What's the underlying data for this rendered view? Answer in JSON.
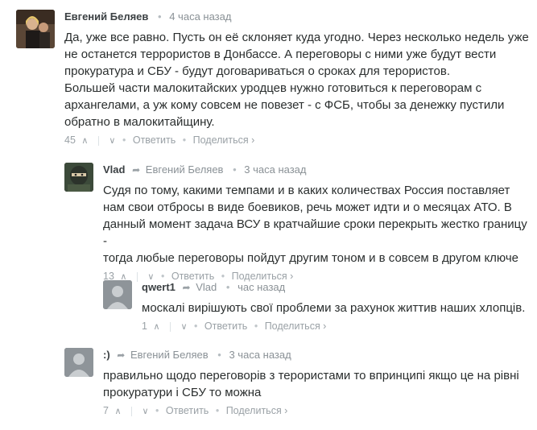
{
  "comments": [
    {
      "author": "Евгений Беляев",
      "reply_to": "",
      "time": "4 часа назад",
      "lines": [
        "Да, уже все равно. Пусть он её склоняет куда угодно. Через несколько недель уже",
        "не останется террористов в Донбассе. А переговоры с ними уже будут вести",
        "прокуратура и СБУ - будут договариваться о сроках для терористов.",
        "Большей части малокитайских уродцев нужно готовиться к переговорам с",
        "архангелами, а уж кому совсем не повезет - с ФСБ, чтобы за денежку пустили",
        "обратно в малокитайщину."
      ],
      "votes": "45",
      "reply_label": "Ответить",
      "share_label": "Поделиться ›"
    },
    {
      "author": "Vlad",
      "reply_to": "Евгений Беляев",
      "time": "3 часа назад",
      "lines": [
        "Судя по тому, какими темпами и в каких количествах Россия поставляет",
        "нам свои отбросы в виде боевиков, речь может идти и о месяцах АТО. В",
        "данный момент задача ВСУ в кратчайшие сроки перекрыть жестко границу -",
        "тогда любые переговоры пойдут другим тоном и в совсем в другом ключе"
      ],
      "votes": "13",
      "reply_label": "Ответить",
      "share_label": "Поделиться ›"
    },
    {
      "author": "qwert1",
      "reply_to": "Vlad",
      "time": "час назад",
      "lines": [
        "москалі вирішують свої проблеми за рахунок життив наших хлопців."
      ],
      "votes": "1",
      "reply_label": "Ответить",
      "share_label": "Поделиться ›"
    },
    {
      "author": ":)",
      "reply_to": "Евгений Беляев",
      "time": "3 часа назад",
      "lines": [
        "правильно щодо переговорів з терористами то впринципі якщо це на рівні",
        "прокуратури і СБУ то можна"
      ],
      "votes": "7",
      "reply_label": "Ответить",
      "share_label": "Поделиться ›"
    }
  ]
}
